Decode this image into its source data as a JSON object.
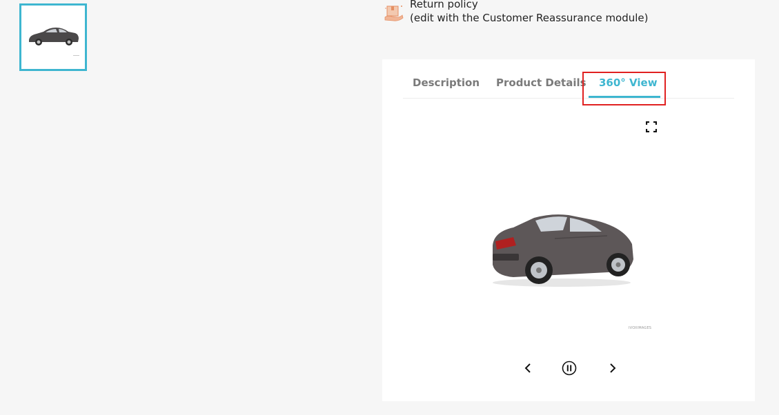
{
  "gallery": {
    "thumbnail_watermark": ""
  },
  "reassurance": {
    "line1": "Return policy",
    "line2": "(edit with the Customer Reassurance module)",
    "icon": "return-box-icon"
  },
  "tabs": [
    {
      "label": "Description",
      "active": false
    },
    {
      "label": "Product Details",
      "active": false
    },
    {
      "label": "360° View",
      "active": true
    }
  ],
  "viewer": {
    "watermark": "IVOXIMAGES",
    "fullscreen_icon": "fullscreen-icon",
    "controls": {
      "prev_icon": "chevron-left-icon",
      "pause_icon": "pause-circle-icon",
      "next_icon": "chevron-right-icon"
    }
  },
  "colors": {
    "accent": "#3eb6d0",
    "highlight": "#e02020",
    "background": "#f6f6f6",
    "panel": "#ffffff",
    "tab_inactive": "#7a7a7a"
  }
}
